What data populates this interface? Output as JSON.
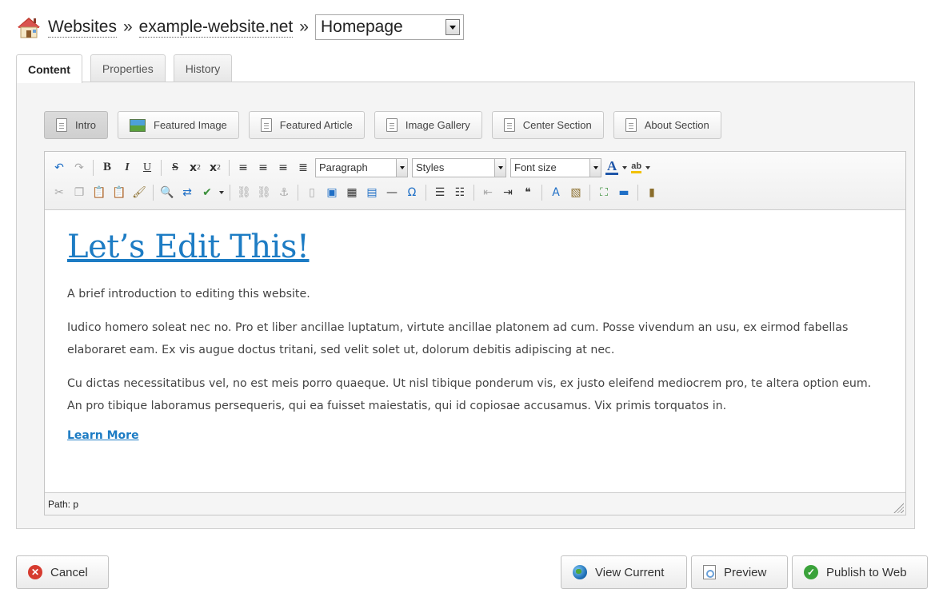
{
  "header": {
    "icon": "house-icon",
    "crumbs": [
      "Websites",
      "example-website.net"
    ],
    "separator": "»",
    "page_select_value": "Homepage"
  },
  "tabs": [
    {
      "label": "Content",
      "active": true
    },
    {
      "label": "Properties",
      "active": false
    },
    {
      "label": "History",
      "active": false
    }
  ],
  "sections": [
    {
      "label": "Intro",
      "icon": "document-icon",
      "active": true
    },
    {
      "label": "Featured Image",
      "icon": "image-icon",
      "active": false
    },
    {
      "label": "Featured Article",
      "icon": "document-icon",
      "active": false
    },
    {
      "label": "Image Gallery",
      "icon": "document-icon",
      "active": false
    },
    {
      "label": "Center Section",
      "icon": "document-icon",
      "active": false
    },
    {
      "label": "About Section",
      "icon": "document-icon",
      "active": false
    }
  ],
  "toolbar": {
    "format_select": "Paragraph",
    "styles_select": "Styles",
    "fontsize_select": "Font size",
    "subscript_label": "x",
    "superscript_label": "x",
    "highlight_label": "ab"
  },
  "content": {
    "heading": "Let’s Edit This!",
    "paragraphs": [
      "A brief introduction to editing this website.",
      "Iudico homero soleat nec no. Pro et liber ancillae luptatum, virtute ancillae platonem ad cum. Posse vivendum an usu, ex eirmod fabellas elaboraret eam. Ex vis augue doctus tritani, sed velit solet ut, dolorum debitis adipiscing at nec.",
      "Cu dictas necessitatibus vel, no est meis porro quaeque. Ut nisl tibique ponderum vis, ex justo eleifend mediocrem pro, te altera option eum. An pro tibique laboramus persequeris, qui ea fuisset maiestatis, qui id copiosae accusamus. Vix primis torquatos in."
    ],
    "link": "Learn More"
  },
  "statusbar": {
    "path": "Path: p"
  },
  "footer": {
    "cancel": "Cancel",
    "view_current": "View Current",
    "preview": "Preview",
    "publish": "Publish to Web"
  },
  "colors": {
    "link_blue": "#1d7cc4",
    "cancel_red": "#d63b2f",
    "publish_green": "#3aa23a"
  }
}
